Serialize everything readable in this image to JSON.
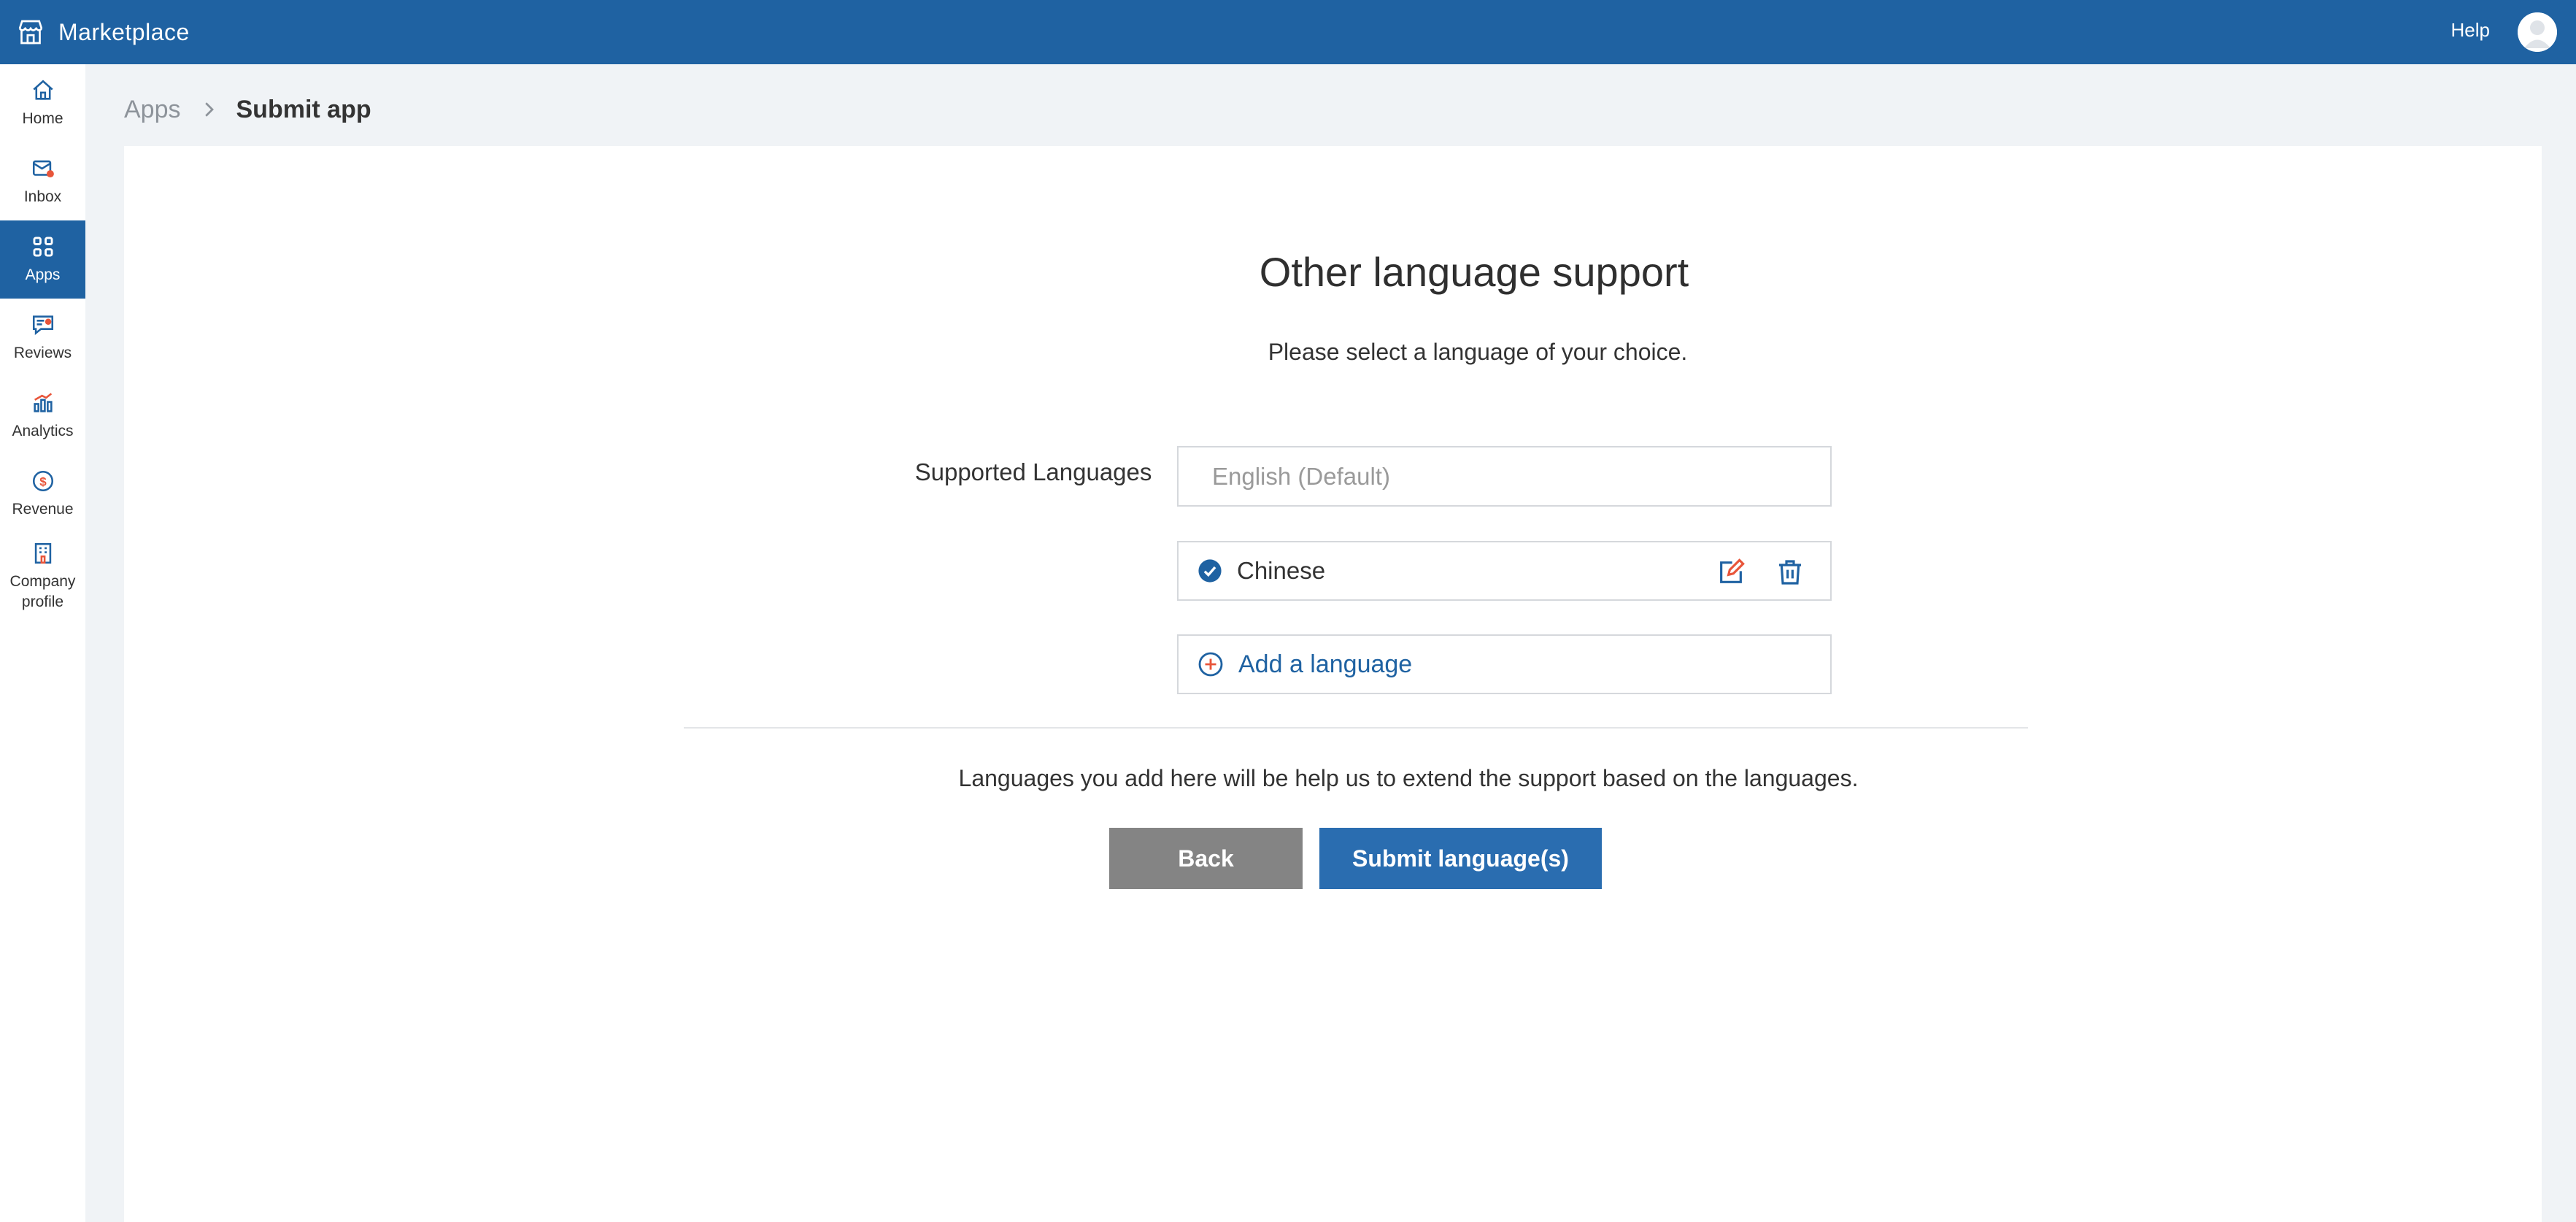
{
  "app": {
    "title": "Marketplace"
  },
  "header": {
    "help_label": "Help"
  },
  "sidebar": {
    "items": [
      {
        "label": "Home",
        "icon": "home-icon"
      },
      {
        "label": "Inbox",
        "icon": "inbox-icon"
      },
      {
        "label": "Apps",
        "icon": "apps-grid-icon",
        "active": true
      },
      {
        "label": "Reviews",
        "icon": "reviews-icon"
      },
      {
        "label": "Analytics",
        "icon": "analytics-icon"
      },
      {
        "label": "Revenue",
        "icon": "revenue-icon"
      },
      {
        "label": "Company profile",
        "icon": "company-profile-icon"
      }
    ]
  },
  "breadcrumb": {
    "parent": "Apps",
    "current": "Submit app"
  },
  "main": {
    "title": "Other language support",
    "subtitle": "Please select a language of your choice.",
    "supported_label": "Supported Languages",
    "default_language": "English (Default)",
    "languages": [
      {
        "name": "Chinese",
        "selected": true
      }
    ],
    "add_language_label": "Add a language",
    "note": "Languages you add here will be help us to extend the support based on the languages.",
    "back_label": "Back",
    "submit_label": "Submit language(s)"
  },
  "colors": {
    "brand": "#1f62a2",
    "accent_orange": "#e8553a",
    "back_button": "#848484",
    "submit_button": "#2a6db0"
  }
}
